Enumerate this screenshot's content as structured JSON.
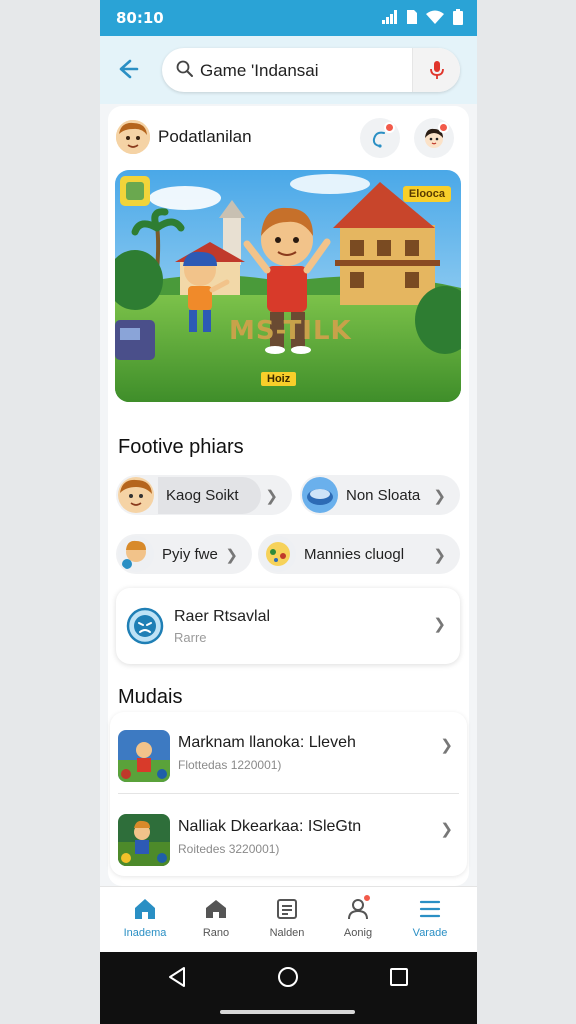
{
  "status_bar": {
    "time": "80:10",
    "icons": [
      "signal-icon",
      "sim-icon",
      "wifi-icon",
      "battery-icon"
    ]
  },
  "search": {
    "query": "Game 'Indansai",
    "icons": [
      "back-arrow-icon",
      "search-icon",
      "microphone-icon"
    ]
  },
  "profile": {
    "name": "Podatlanilan"
  },
  "banner": {
    "tag": "Elooca",
    "title": "MS-TILK",
    "button": "Hoiz"
  },
  "featured": {
    "title": "Footive phiars",
    "chips": [
      {
        "label": "Kaog Soikt"
      },
      {
        "label": "Non Sloata"
      },
      {
        "label": "Pyiy fwe"
      },
      {
        "label": "Mannies cluogl"
      }
    ]
  },
  "card": {
    "title": "Raer Rtsavlal",
    "subtitle": "Rarre"
  },
  "section2": {
    "title": "Mudais",
    "items": [
      {
        "title": "Marknam llanoka: Lleveh",
        "subtitle": "Flottedas 1220001)"
      },
      {
        "title": "Nalliak Dkearkaa: ISleGtn",
        "subtitle": "Roitedes 3220001)"
      }
    ]
  },
  "tabs": [
    {
      "label": "Inadema",
      "icon": "home-icon",
      "active": true
    },
    {
      "label": "Rano",
      "icon": "house-icon",
      "active": false
    },
    {
      "label": "Nalden",
      "icon": "list-card-icon",
      "active": false
    },
    {
      "label": "Aonig",
      "icon": "profile-icon",
      "active": false
    },
    {
      "label": "Varade",
      "icon": "menu-icon",
      "active": true
    }
  ],
  "colors": {
    "accent": "#2a8fc4",
    "status_bar": "#2aa3d6",
    "badge": "#f25a4a"
  }
}
